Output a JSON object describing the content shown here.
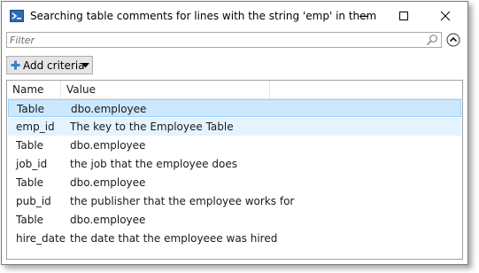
{
  "window": {
    "title": "Searching table comments for lines with the string 'emp' in them"
  },
  "filter": {
    "placeholder": "Filter"
  },
  "toolbar": {
    "add_criteria_label": "Add criteria"
  },
  "table": {
    "columns": [
      "Name",
      "Value"
    ],
    "rows": [
      {
        "name": "Table",
        "value": "dbo.employee",
        "state": "selected"
      },
      {
        "name": "emp_id",
        "value": "The key to the Employee Table",
        "state": "highlighted"
      },
      {
        "name": "Table",
        "value": "dbo.employee",
        "state": "normal"
      },
      {
        "name": "job_id",
        "value": "the job that the employee does",
        "state": "normal"
      },
      {
        "name": "Table",
        "value": "dbo.employee",
        "state": "normal"
      },
      {
        "name": "pub_id",
        "value": "the publisher that the employee works for",
        "state": "normal"
      },
      {
        "name": "Table",
        "value": "dbo.employee",
        "state": "normal"
      },
      {
        "name": "hire_date",
        "value": "the date that the employeee was hired",
        "state": "normal"
      }
    ]
  },
  "colors": {
    "selected_row": "#cce8ff",
    "highlighted_row": "#e5f3ff",
    "accent": "#0078d7"
  },
  "icons": {
    "app": "powershell-icon",
    "minimize": "minimize-icon",
    "maximize": "maximize-icon",
    "close": "close-icon",
    "search": "search-icon",
    "collapse": "chevron-up-circle-icon",
    "add": "plus-icon",
    "dropdown": "dropdown-arrow-icon"
  }
}
